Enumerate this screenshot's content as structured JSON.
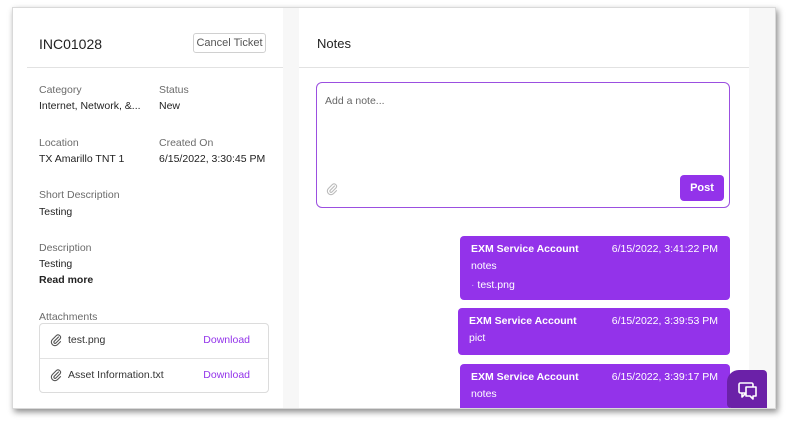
{
  "ticket": {
    "id": "INC01028",
    "cancel_label": "Cancel Ticket"
  },
  "fields": {
    "category_label": "Category",
    "category_value": "Internet, Network, &...",
    "status_label": "Status",
    "status_value": "New",
    "location_label": "Location",
    "location_value": "TX Amarillo TNT 1",
    "created_label": "Created On",
    "created_value": "6/15/2022, 3:30:45 PM",
    "short_desc_label": "Short Description",
    "short_desc_value": "Testing",
    "desc_label": "Description",
    "desc_value": "Testing",
    "read_more": "Read more"
  },
  "attachments": {
    "label": "Attachments",
    "items": [
      {
        "name": "test.png",
        "action": "Download"
      },
      {
        "name": "Asset Information.txt",
        "action": "Download"
      }
    ]
  },
  "notes": {
    "title": "Notes",
    "placeholder": "Add a note...",
    "post_label": "Post",
    "messages": [
      {
        "author": "EXM Service Account",
        "time": "6/15/2022, 3:41:22 PM",
        "text": "notes",
        "attachment": "test.png"
      },
      {
        "author": "EXM Service Account",
        "time": "6/15/2022, 3:39:53 PM",
        "text": "pict"
      },
      {
        "author": "EXM Service Account",
        "time": "6/15/2022, 3:39:17 PM",
        "text": "notes"
      }
    ]
  },
  "colors": {
    "accent": "#9333ea",
    "chat_button": "#6b21a8"
  },
  "icons": {
    "attachment": "paperclip-icon",
    "chat": "chat-bubbles-icon"
  }
}
